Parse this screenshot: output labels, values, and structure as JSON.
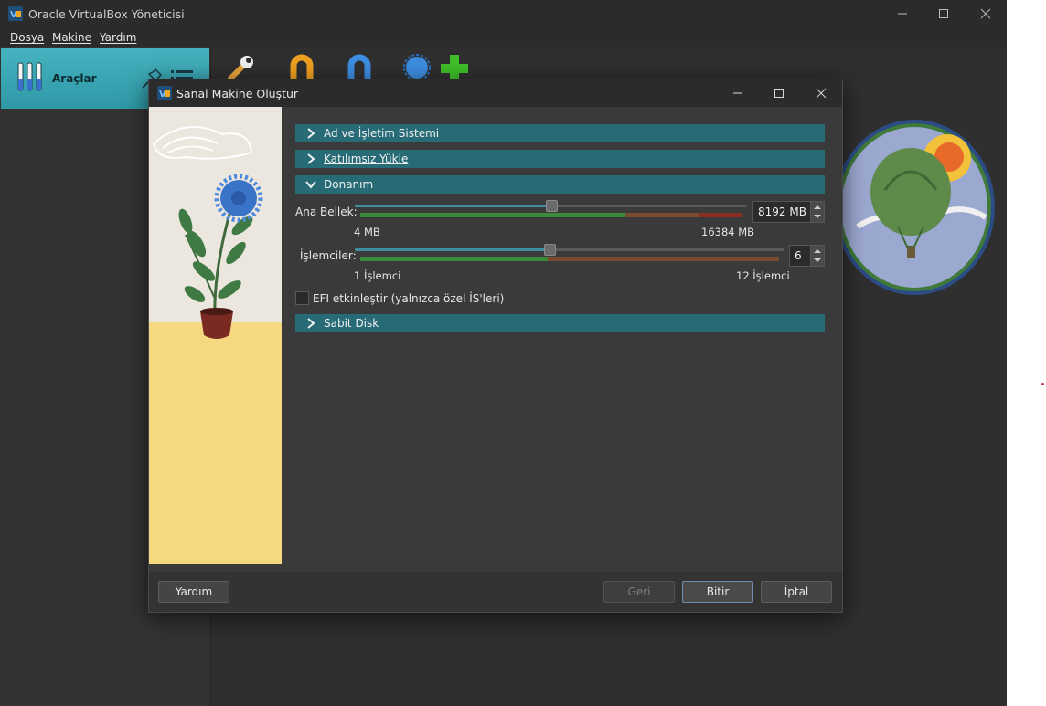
{
  "main_window": {
    "title": "Oracle VirtualBox Yöneticisi",
    "menu": [
      "Dosya",
      "Makine",
      "Yardım"
    ],
    "tools_label": "Araçlar"
  },
  "dialog": {
    "title": "Sanal Makine Oluştur",
    "sections": {
      "name_os": "Ad ve İşletim Sistemi",
      "unattended": "Katılımsız Yükle",
      "hardware": "Donanım",
      "hard_disk": "Sabit Disk"
    },
    "memory": {
      "label": "Ana Bellek:",
      "value": "8192 MB",
      "min_label": "4 MB",
      "max_label": "16384 MB",
      "level": 0.5
    },
    "cpus": {
      "label": "İşlemciler:",
      "value": "6",
      "min_label": "1 İşlemci",
      "max_label": "12 İşlemci",
      "level": 0.4545
    },
    "efi_label": "EFI etkinleştir (yalnızca özel İS'leri)",
    "efi_checked": false,
    "buttons": {
      "help": "Yardım",
      "back": "Geri",
      "finish": "Bitir",
      "cancel": "İptal"
    }
  },
  "colors": {
    "section_bg": "#266b76",
    "tools_bg": "#3aa6b3",
    "scale_green": "#3f8a3c",
    "scale_red": "#7a3a2a"
  }
}
